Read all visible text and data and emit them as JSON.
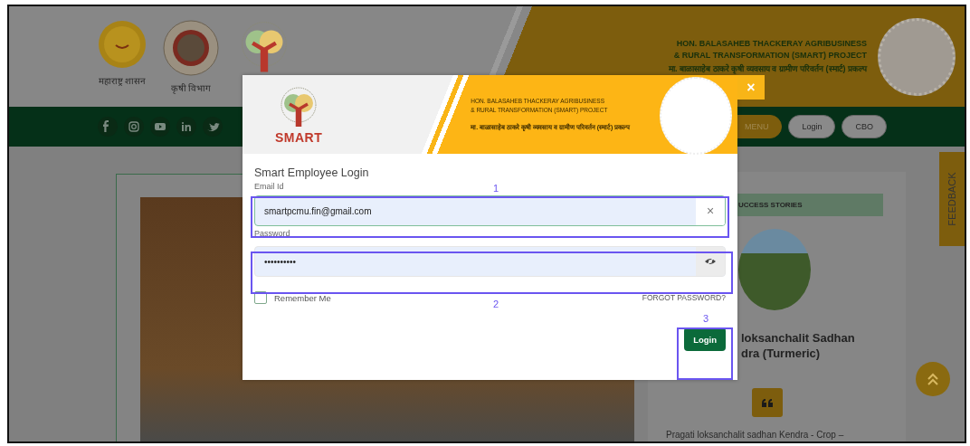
{
  "site_header": {
    "logos": [
      {
        "caption": "महाराष्ट्र शासन"
      },
      {
        "caption": "कृषी विभाग"
      }
    ],
    "title_lines": [
      "HON. BALASAHEB THACKERAY AGRIBUSINESS",
      "& RURAL TRANSFORMATION (SMART) PROJECT",
      "मा. बाळासाहेब ठाकरे कृषी व्यवसाय व ग्रामीण परिवर्तन (स्मार्ट) प्रकल्प"
    ]
  },
  "nav_bar": {
    "buttons": [
      {
        "label": "MENU"
      },
      {
        "label": "Login"
      },
      {
        "label": "CBO"
      }
    ]
  },
  "main": {
    "success_stories": {
      "heading": "UCCESS STORIES",
      "story_title_lines": [
        "loksanchalit Sadhan",
        "dra (Turmeric)"
      ],
      "excerpt": "Pragati loksanchalit sadhan Kendra - Crop –"
    },
    "feedback_tab": "FEEDBACK"
  },
  "login_modal": {
    "logo_text": "SMART",
    "header_lines": [
      "HON. BALASAHEB THACKERAY AGRIBUSINESS",
      "& RURAL TRANSFORMATION (SMART) PROJECT",
      "मा. बाळासाहेब ठाकरे कृषी व्यवसाय व ग्रामीण परिवर्तन (स्मार्ट) प्रकल्प"
    ],
    "close": "×",
    "title": "Smart Employee Login",
    "email": {
      "label": "Email Id",
      "value": "smartpcmu.fin@gmail.com",
      "clear": "×"
    },
    "password": {
      "label": "Password",
      "value": "••••••••••"
    },
    "remember_me": {
      "label": "Remember Me",
      "checked": false
    },
    "forgot_link": "FORGOT PASSWORD?",
    "submit": "Login"
  },
  "annotations": [
    {
      "number": "1"
    },
    {
      "number": "2"
    },
    {
      "number": "3"
    }
  ]
}
